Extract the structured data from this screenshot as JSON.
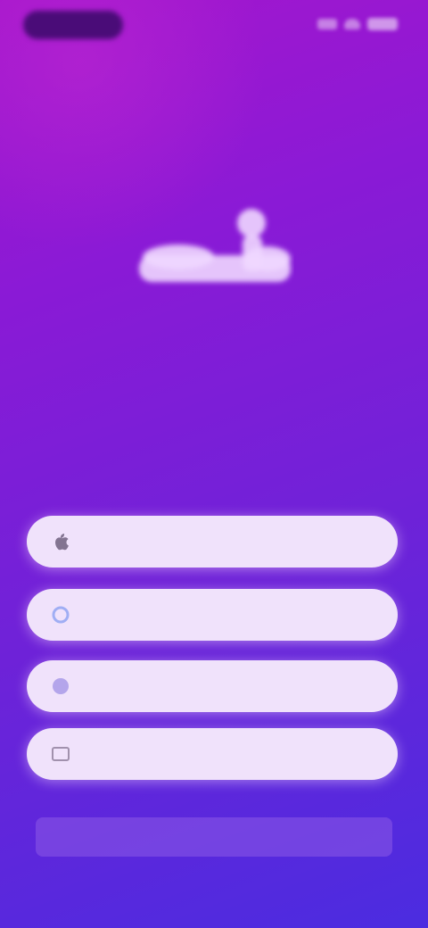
{
  "status_bar": {
    "time": "",
    "icons": [
      "signal-icon",
      "wifi-icon",
      "battery-icon"
    ]
  },
  "brand": {
    "logo_name": "app-logo",
    "tagline": "",
    "colors": {
      "gradient_top": "#a516cc",
      "gradient_bottom": "#4b2ce0",
      "button_bg": "#f0e2fb"
    }
  },
  "login_buttons": [
    {
      "label": "",
      "icon": "apple-icon"
    },
    {
      "label": "",
      "icon": "google-icon"
    },
    {
      "label": "",
      "icon": "facebook-icon"
    },
    {
      "label": "",
      "icon": "email-icon"
    }
  ],
  "more_options": {
    "label": ""
  }
}
